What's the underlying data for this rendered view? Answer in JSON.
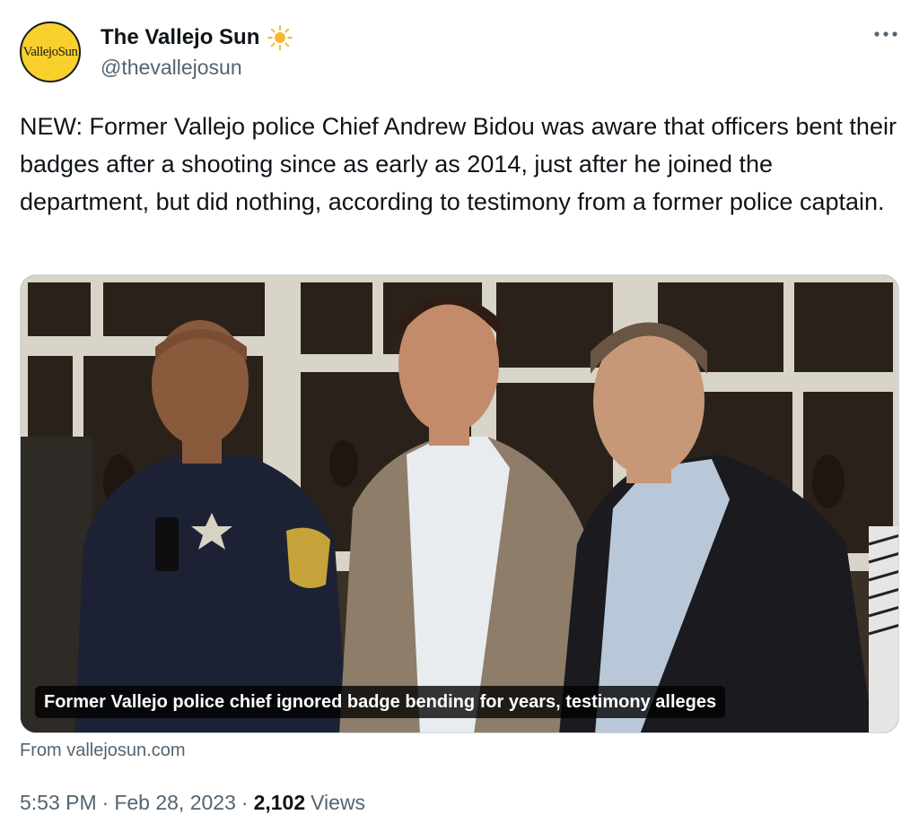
{
  "author": {
    "name": "The Vallejo Sun",
    "handle": "@thevallejosun",
    "avatar_text": "VallejoSun",
    "avatar_color": "#f7d02c",
    "badge_icon": "sun-icon"
  },
  "more_icon": "more-horizontal-icon",
  "tweet": {
    "text": "NEW: Former Vallejo police Chief Andrew Bidou was aware that officers bent their badges after a shooting since as early as 2014, just after he joined the department, but did nothing, according to testimony from a former police captain."
  },
  "card": {
    "caption": "Former Vallejo police chief ignored badge bending for years, testimony alleges",
    "source": "From vallejosun.com"
  },
  "meta": {
    "time": "5:53 PM",
    "separator": "·",
    "date": "Feb 28, 2023",
    "views_count": "2,102",
    "views_label": "Views"
  },
  "colors": {
    "text_primary": "#0f1419",
    "text_secondary": "#536471",
    "border": "#cfd9de"
  }
}
